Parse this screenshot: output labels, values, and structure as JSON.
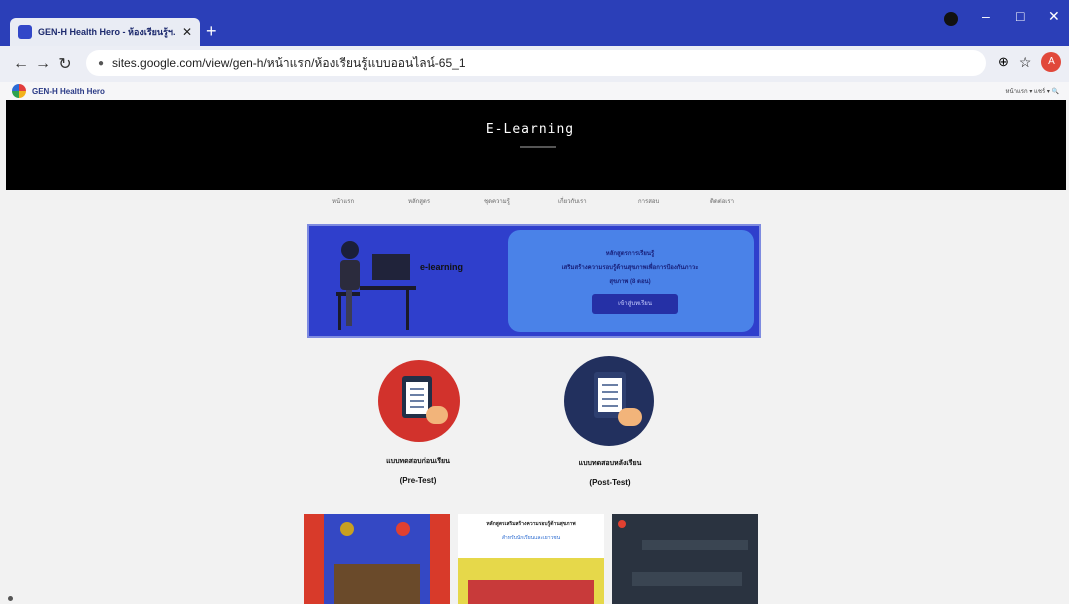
{
  "browser": {
    "tab_title": "GEN-H Health Hero - ห้องเรียนรู้ฯ...",
    "tab_close": "✕",
    "new_tab": "+",
    "back": "←",
    "forward": "→",
    "reload": "↻",
    "url": "sites.google.com/view/gen-h/หน้าแรก/ห้องเรียนรู้แบบออนไลน์-65_1",
    "zoom_icon": "⊕",
    "star_icon": "☆",
    "avatar_letter": "A",
    "menu_icon": "⋮",
    "minimize": "–",
    "maximize": "□",
    "close": "✕"
  },
  "site": {
    "name": "GEN-H Health Hero",
    "right_links": "หน้าแรก ▾   แชร์ ▾   🔍"
  },
  "hero": {
    "title": "E-Learning"
  },
  "nav": {
    "items": [
      "หน้าแรก",
      "หลักสูตร",
      "ชุดความรู้",
      "เกี่ยวกับเรา",
      "การสอบ",
      "ติดต่อเรา"
    ]
  },
  "banner": {
    "label": "e-learning",
    "line1": "หลักสูตรการเรียนรู้",
    "line2": "เสริมสร้างความรอบรู้ด้านสุขภาพเพื่อการป้องกันภาวะ",
    "line3": "สุขภาพ (8 ตอน)",
    "button": "เข้าสู่บทเรียน"
  },
  "tests": {
    "pre_label": "แบบทดสอบก่อนเรียน",
    "pre_sub": "(Pre-Test)",
    "post_label": "แบบทดสอบหลังเรียน",
    "post_sub": "(Post-Test)"
  },
  "thumbs": {
    "middle_title": "หลักสูตรเสริมสร้างความรอบรู้ด้านสุขภาพ",
    "middle_sub": "สำหรับนักเรียนและเยาวชน"
  },
  "colors": {
    "tabstrip": "#2b3fb8",
    "banner": "#2f3fcc",
    "pre_circle": "#d2322c",
    "post_circle": "#22305e"
  }
}
